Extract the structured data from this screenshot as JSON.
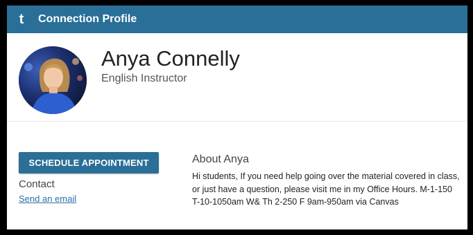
{
  "header": {
    "logo_text": "t",
    "title": "Connection Profile",
    "bar_color": "#2a6f97"
  },
  "profile": {
    "name": "Anya Connelly",
    "role": "English Instructor",
    "avatar": "profile-photo"
  },
  "actions": {
    "schedule_label": "SCHEDULE APPOINTMENT"
  },
  "contact": {
    "heading": "Contact",
    "email_link": "Send an email"
  },
  "about": {
    "heading": "About Anya",
    "text": "Hi students, If you need help going over the material covered in class, or just have a question, please visit me in my Office Hours. M-1-150 T-10-1050am W& Th 2-250 F 9am-950am via Canvas"
  }
}
